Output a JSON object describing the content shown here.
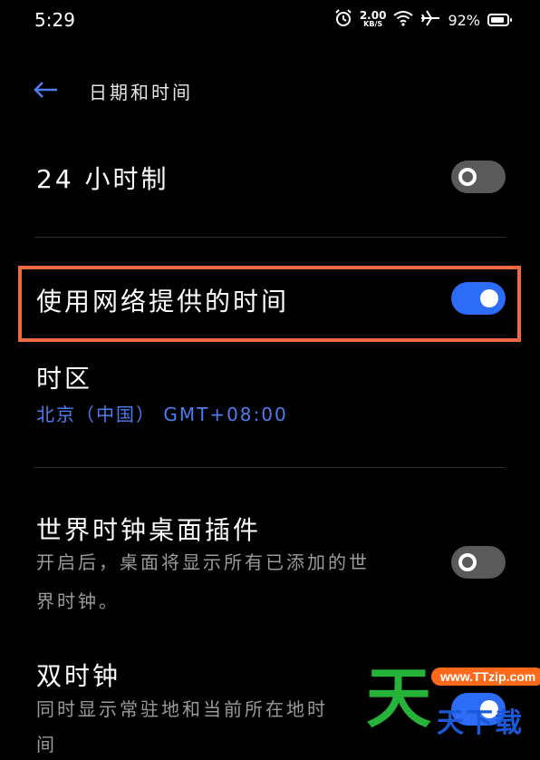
{
  "status_bar": {
    "time": "5:29",
    "net_speed_value": "2.00",
    "net_speed_unit": "KB/S",
    "battery": "92%"
  },
  "header": {
    "title": "日期和时间"
  },
  "settings": {
    "hour24": {
      "label": "24 小时制",
      "enabled": false
    },
    "network_time": {
      "label": "使用网络提供的时间",
      "enabled": true
    },
    "timezone": {
      "label": "时区",
      "value": "北京（中国） GMT+08:00"
    },
    "world_clock": {
      "label": "世界时钟桌面插件",
      "desc_line1": "开启后，桌面将显示所有已添加的世",
      "desc_line2": "界时钟。",
      "enabled": false
    },
    "dual_clock": {
      "label": "双时钟",
      "desc_line1": "同时显示常驻地和当前所在地时",
      "desc_line2": "间",
      "enabled": true
    }
  },
  "watermark": {
    "badge": "www.TTzip.com",
    "big": "天",
    "small": "天下载"
  },
  "colors": {
    "accent": "#2d6cf6",
    "highlight": "#ef6a3c",
    "link": "#4d7df0"
  }
}
